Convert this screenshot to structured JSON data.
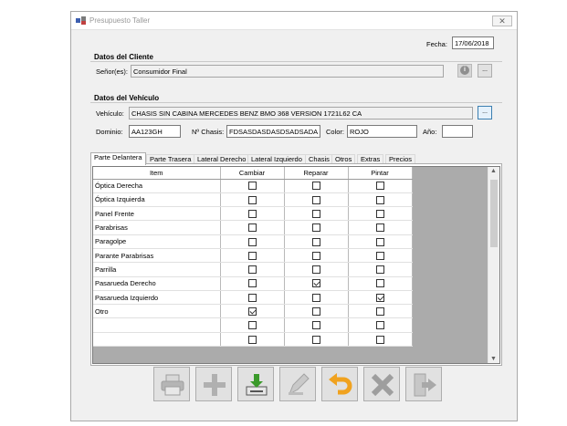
{
  "window": {
    "title": "Presupuesto Taller",
    "close_glyph": "✕"
  },
  "header": {
    "fecha_label": "Fecha:",
    "fecha_value": "17/06/2018"
  },
  "cliente": {
    "group_title": "Datos del Cliente",
    "senores_label": "Señor(es):",
    "senores_value": "Consumidor Final",
    "info_glyph": "i",
    "lookup_label": "..."
  },
  "vehiculo": {
    "group_title": "Datos del Vehículo",
    "vehiculo_label": "Vehículo:",
    "vehiculo_value": "CHASIS SIN CABINA MERCEDES BENZ BMO 368 VERSION 1721L62 CA",
    "lookup_label": "...",
    "dominio_label": "Dominio:",
    "dominio_value": "AA123GH",
    "chasis_label": "Nº Chasis:",
    "chasis_value": "FDSASDASDASDSADSADA",
    "color_label": "Color:",
    "color_value": "ROJO",
    "anio_label": "Año:",
    "anio_value": ""
  },
  "tabs": [
    {
      "label": "Parte Delantera",
      "active": true
    },
    {
      "label": "Parte Trasera"
    },
    {
      "label": "Lateral Derecho"
    },
    {
      "label": "Lateral Izquierdo"
    },
    {
      "label": "Chasis"
    },
    {
      "label": "Otros"
    },
    {
      "label": "Extras"
    },
    {
      "label": "Precios"
    }
  ],
  "grid": {
    "columns": [
      "Item",
      "Cambiar",
      "Reparar",
      "Pintar"
    ],
    "rows": [
      {
        "item": "Óptica Derecha",
        "cambiar": false,
        "reparar": false,
        "pintar": false
      },
      {
        "item": "Óptica Izquierda",
        "cambiar": false,
        "reparar": false,
        "pintar": false
      },
      {
        "item": "Panel Frente",
        "cambiar": false,
        "reparar": false,
        "pintar": false
      },
      {
        "item": "Parabrisas",
        "cambiar": false,
        "reparar": false,
        "pintar": false
      },
      {
        "item": "Paragolpe",
        "cambiar": false,
        "reparar": false,
        "pintar": false
      },
      {
        "item": "Parante Parabrisas",
        "cambiar": false,
        "reparar": false,
        "pintar": false
      },
      {
        "item": "Parrilla",
        "cambiar": false,
        "reparar": false,
        "pintar": false
      },
      {
        "item": "Pasarueda Derecho",
        "cambiar": false,
        "reparar": true,
        "pintar": false
      },
      {
        "item": "Pasarueda Izquierdo",
        "cambiar": false,
        "reparar": false,
        "pintar": true
      },
      {
        "item": "Otro",
        "cambiar": true,
        "reparar": false,
        "pintar": false
      },
      {
        "item": "",
        "cambiar": false,
        "reparar": false,
        "pintar": false
      },
      {
        "item": "",
        "cambiar": false,
        "reparar": false,
        "pintar": false
      }
    ],
    "scroll_up_glyph": "▲",
    "scroll_down_glyph": "▼"
  },
  "toolbar": [
    {
      "icon": "printer-icon",
      "enabled": false
    },
    {
      "icon": "plus-icon",
      "enabled": false
    },
    {
      "icon": "download-icon",
      "enabled": true
    },
    {
      "icon": "edit-icon",
      "enabled": false
    },
    {
      "icon": "undo-icon",
      "enabled": true
    },
    {
      "icon": "delete-icon",
      "enabled": false
    },
    {
      "icon": "exit-icon",
      "enabled": false
    }
  ],
  "colors": {
    "undo_arrow": "#f0a21f",
    "download_green": "#3a9a2a",
    "disabled_gray": "#9e9e9e"
  }
}
